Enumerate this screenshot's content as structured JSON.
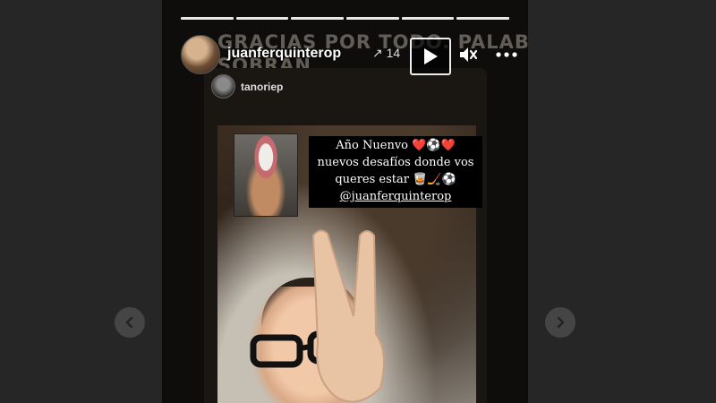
{
  "story": {
    "segments": 6,
    "caption_bg": "GRACIAS POR TODO. PALABRAS\nSOBRAN",
    "username": "juanferquinterop",
    "username_extra": "↗ 14",
    "controls": {
      "play_icon": "play-icon",
      "mute_icon": "mute-icon",
      "more_icon": "more-icon"
    }
  },
  "shared_post": {
    "username": "tanoriep",
    "sticker": {
      "line1": "Año Nuenvo ❤️⚽❤️",
      "line2": "nuevos desafíos donde vos",
      "line3": "queres estar 🥃🏒⚽",
      "mention": "@juanferquinterop"
    }
  },
  "nav": {
    "prev_icon": "chevron-left-icon",
    "next_icon": "chevron-right-icon"
  },
  "colors": {
    "page_bg": "#262626",
    "story_bg": "#0e0d0c",
    "nav_bg": "#454545"
  }
}
